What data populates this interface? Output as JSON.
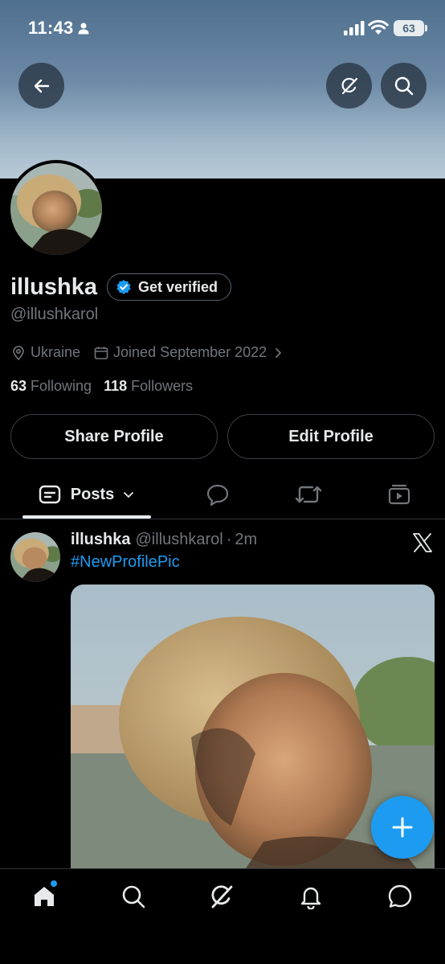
{
  "status_bar": {
    "time": "11:43",
    "battery": "63"
  },
  "header": {
    "back_icon": "arrow-left-icon",
    "grok_icon": "grok-icon",
    "search_icon": "search-icon"
  },
  "profile": {
    "display_name": "illushka",
    "get_verified_label": "Get verified",
    "handle": "@illushkarol",
    "location": "Ukraine",
    "joined": "Joined September 2022",
    "following_count": "63",
    "following_label": "Following",
    "followers_count": "118",
    "followers_label": "Followers",
    "share_label": "Share Profile",
    "edit_label": "Edit Profile"
  },
  "tabs": {
    "posts_label": "Posts",
    "icons": [
      "posts-icon",
      "replies-icon",
      "reposts-icon",
      "media-icon"
    ]
  },
  "post": {
    "author": "illushka",
    "handle": "@illushkarol",
    "separator": "·",
    "time": "2m",
    "hashtag": "#NewProfilePic"
  },
  "colors": {
    "accent": "#1d9bf0",
    "background": "#000000",
    "muted": "#71767b",
    "text": "#e7e9ea"
  },
  "bottom_nav": [
    "home-icon",
    "search-icon",
    "grok-icon",
    "notifications-icon",
    "messages-icon"
  ]
}
